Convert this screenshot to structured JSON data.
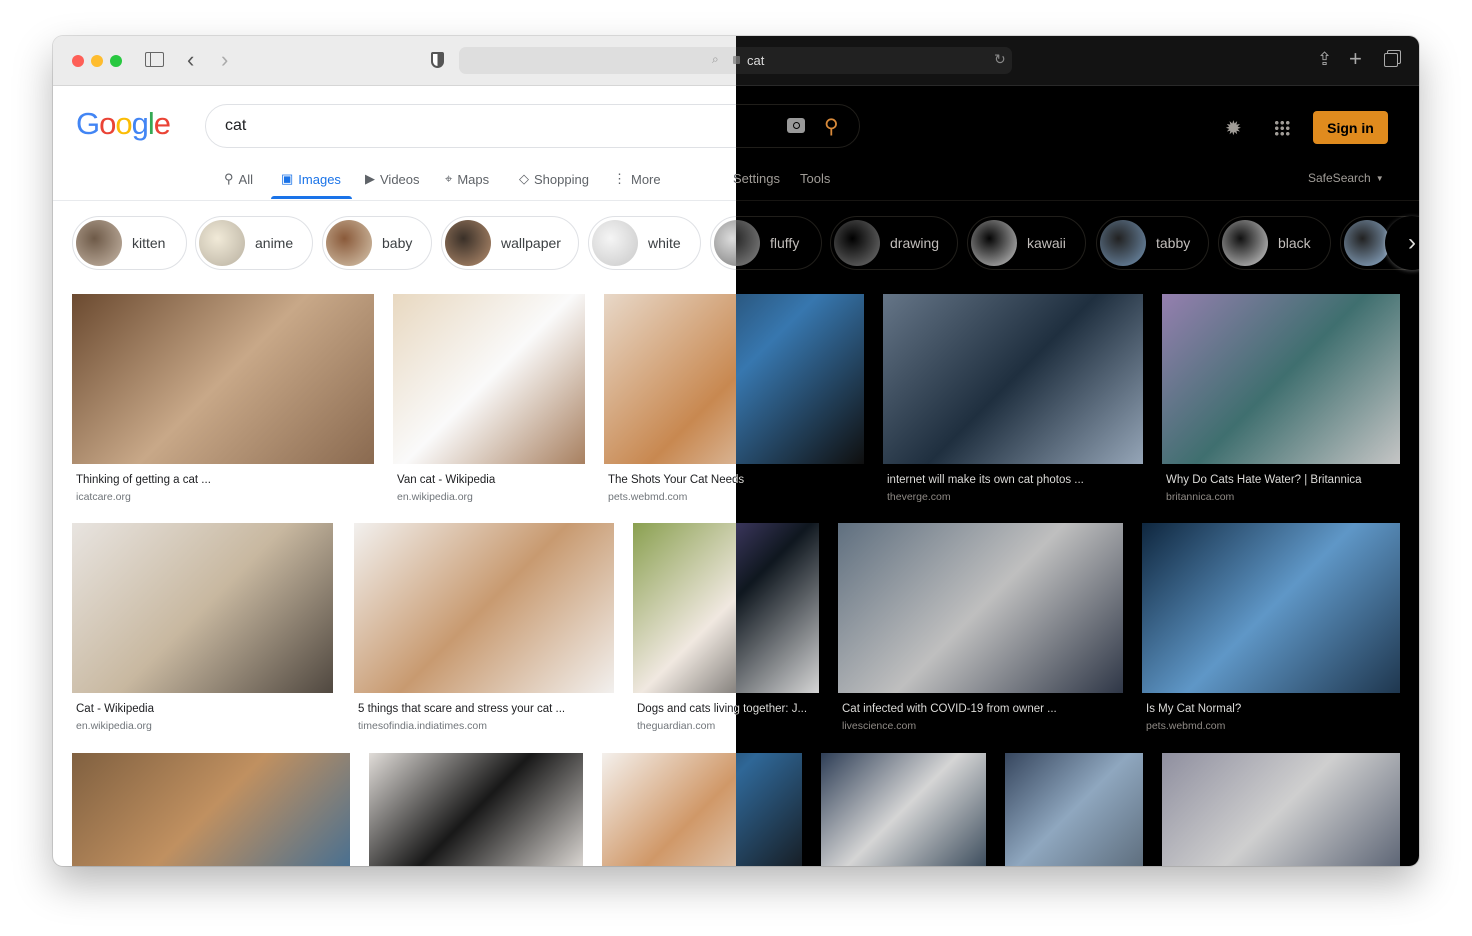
{
  "browser": {
    "address": "cat",
    "icons": [
      "sidebar-icon",
      "back-icon",
      "forward-icon",
      "shield-icon",
      "search-icon",
      "lock-icon",
      "reload-icon",
      "share-icon",
      "new-tab-icon",
      "tabs-icon"
    ]
  },
  "google": {
    "logo": "Google",
    "query": "cat",
    "sign_in": "Sign in",
    "safesearch": "SafeSearch",
    "settings": "Settings",
    "tools": "Tools",
    "tabs": [
      {
        "label": "All",
        "icon": "search-icon"
      },
      {
        "label": "Images",
        "icon": "image-icon",
        "active": true
      },
      {
        "label": "Videos",
        "icon": "video-icon"
      },
      {
        "label": "Maps",
        "icon": "map-pin-icon"
      },
      {
        "label": "Shopping",
        "icon": "tag-icon"
      },
      {
        "label": "More",
        "icon": "dots-vertical-icon"
      }
    ],
    "accent": "#1a73e8"
  },
  "chips": [
    "kitten",
    "anime",
    "baby",
    "wallpaper",
    "white",
    "fluffy",
    "drawing",
    "kawaii",
    "tabby",
    "black",
    ""
  ],
  "results": [
    {
      "title": "Thinking of getting a cat ...",
      "source": "icatcare.org"
    },
    {
      "title": "Van cat - Wikipedia",
      "source": "en.wikipedia.org"
    },
    {
      "title": "The Shots Your Cat Needs",
      "source": "pets.webmd.com"
    },
    {
      "title": "internet will make its own cat photos ...",
      "source": "theverge.com"
    },
    {
      "title": "Why Do Cats Hate Water? | Britannica",
      "source": "britannica.com"
    },
    {
      "title": "Cat - Wikipedia",
      "source": "en.wikipedia.org"
    },
    {
      "title": "5 things that scare and stress your cat ...",
      "source": "timesofindia.indiatimes.com"
    },
    {
      "title": "Dogs and cats living together: J...",
      "source": "theguardian.com"
    },
    {
      "title": "Cat infected with COVID-19 from owner ...",
      "source": "livescience.com"
    },
    {
      "title": "Is My Cat Normal?",
      "source": "pets.webmd.com"
    },
    {
      "title": "",
      "source": ""
    },
    {
      "title": "",
      "source": ""
    },
    {
      "title": "",
      "source": ""
    },
    {
      "title": "",
      "source": ""
    },
    {
      "title": "",
      "source": ""
    },
    {
      "title": "",
      "source": ""
    }
  ]
}
